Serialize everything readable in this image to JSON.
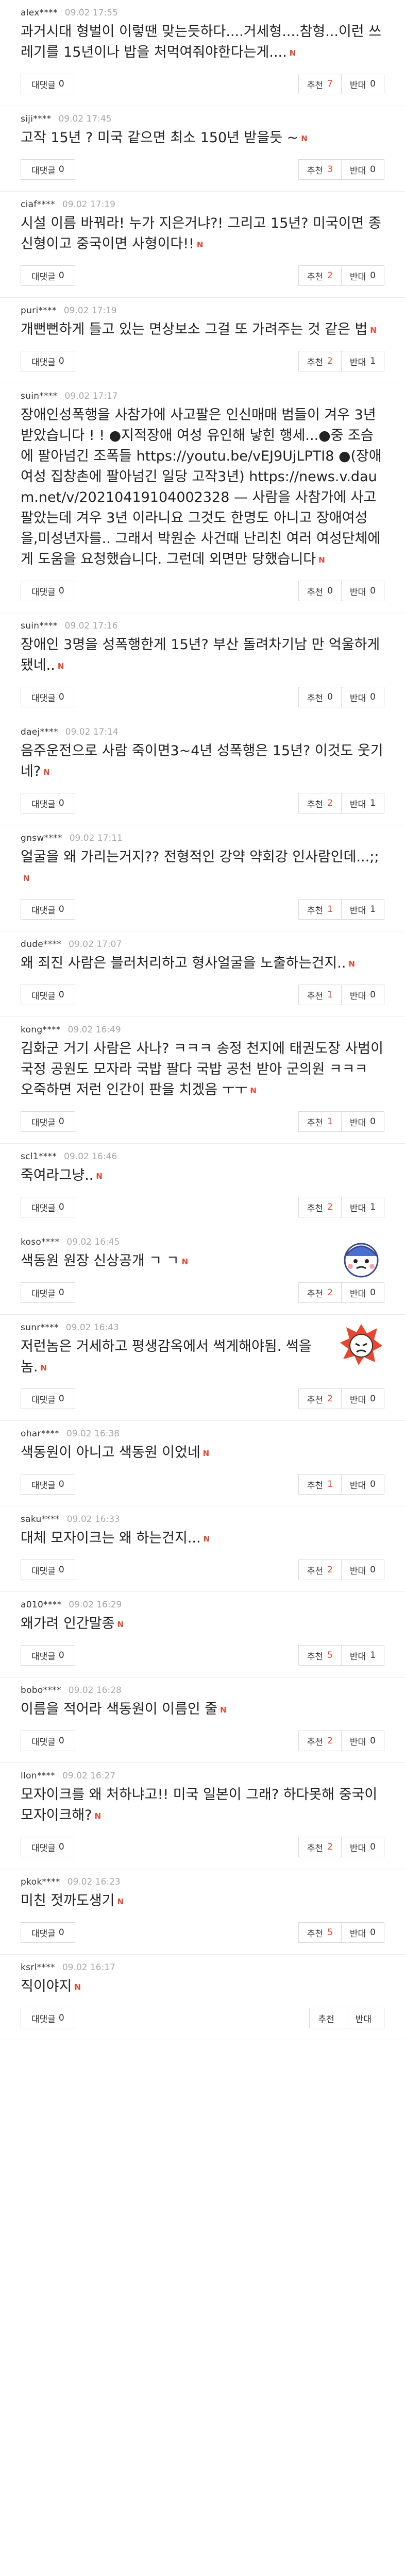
{
  "labels": {
    "reply": "대댓글",
    "up": "추천",
    "down": "반대",
    "new": "N"
  },
  "comments": [
    {
      "nick": "alex****",
      "date": "09.02 17:55",
      "text": "과거시대 형벌이 이렇땐 맞는듯하다....거세형....참형...이런 쓰레기를 15년이나 밥을 처먹여줘야한다는게....",
      "replies": "0",
      "up": "7",
      "down": "0",
      "sticker": ""
    },
    {
      "nick": "siji****",
      "date": "09.02 17:45",
      "text": "고작 15년 ? 미국 같으면 최소 150년 받을듯 ~",
      "replies": "0",
      "up": "3",
      "down": "0",
      "sticker": ""
    },
    {
      "nick": "ciaf****",
      "date": "09.02 17:19",
      "text": "시설 이름 바꿔라! 누가 지은거냐?! 그리고 15년? 미국이면 종신형이고 중국이면 사형이다!!",
      "replies": "0",
      "up": "2",
      "down": "0",
      "sticker": ""
    },
    {
      "nick": "puri****",
      "date": "09.02 17:19",
      "text": "개뻔뻔하게 들고 있는 면상보소 그걸 또 가려주는 것 같은 법",
      "replies": "0",
      "up": "2",
      "down": "1",
      "sticker": ""
    },
    {
      "nick": "suin****",
      "date": "09.02 17:17",
      "text": "장애인성폭행을 사참가에 사고팔은 인신매매 범들이 겨우 3년 받았습니다 ! ! ●지적장애 여성 유인해 낳힌 행세...●중 조슴에 팔아넘긴 조폭들 https://youtu.be/vEJ9UjLPTI8 ●(장애여성 집창촌에 팔아넘긴 일당 고작3년) https://news.v.daum.net/v/20210419104002328 — 사람을 사참가에 사고 팔았는데 겨우 3년 이라니요 그것도 한명도 아니고 장애여성을,미성년자를.. 그래서 박원순 사건때 난리친 여러 여성단체에게 도움을 요청했습니다. 그런데 외면만 당했습니다",
      "replies": "0",
      "up": "0",
      "down": "0",
      "sticker": ""
    },
    {
      "nick": "suin****",
      "date": "09.02 17:16",
      "text": "장애인 3명을 성폭행한게 15년? 부산 돌려차기남 만 억울하게 됐네..",
      "replies": "0",
      "up": "0",
      "down": "0",
      "sticker": ""
    },
    {
      "nick": "daej****",
      "date": "09.02 17:14",
      "text": "음주운전으로 사람 죽이면3~4년 성폭행은 15년? 이것도 웃기네?",
      "replies": "0",
      "up": "2",
      "down": "1",
      "sticker": ""
    },
    {
      "nick": "gnsw****",
      "date": "09.02 17:11",
      "text": "얼굴을 왜 가리는거지?? 전형적인 강약 약회강 인사람인데...;;",
      "replies": "0",
      "up": "1",
      "down": "1",
      "sticker": ""
    },
    {
      "nick": "dude****",
      "date": "09.02 17:07",
      "text": "왜 죄진 사람은 블러처리하고 형사얼굴을 노출하는건지..",
      "replies": "0",
      "up": "1",
      "down": "0",
      "sticker": ""
    },
    {
      "nick": "kong****",
      "date": "09.02 16:49",
      "text": "김화군 거기 사람은 사나? ㅋㅋㅋ 송정 천지에 태권도장 사범이 국정 공원도 모자라 국밥 팔다 국밥 공천 받아 군의원 ㅋㅋㅋ 오죽하면 저런 인간이 판을 치겠음 ㅜㅜ",
      "replies": "0",
      "up": "1",
      "down": "0",
      "sticker": ""
    },
    {
      "nick": "scl1****",
      "date": "09.02 16:46",
      "text": "죽여라그냥..",
      "replies": "0",
      "up": "2",
      "down": "1",
      "sticker": ""
    },
    {
      "nick": "koso****",
      "date": "09.02 16:45",
      "text": "색동원 원장 신상공개 ㄱ ㄱ",
      "replies": "0",
      "up": "2",
      "down": "0",
      "sticker": "blue"
    },
    {
      "nick": "sunr****",
      "date": "09.02 16:43",
      "text": "저런놈은 거세하고 평생감옥에서 썩게해야됨. 썩을놈.",
      "replies": "0",
      "up": "2",
      "down": "0",
      "sticker": "red"
    },
    {
      "nick": "ohar****",
      "date": "09.02 16:38",
      "text": "색동원이 아니고 색동원 이었네",
      "replies": "0",
      "up": "1",
      "down": "0",
      "sticker": ""
    },
    {
      "nick": "saku****",
      "date": "09.02 16:33",
      "text": "대체 모자이크는 왜 하는건지...",
      "replies": "0",
      "up": "2",
      "down": "0",
      "sticker": ""
    },
    {
      "nick": "a010****",
      "date": "09.02 16:29",
      "text": "왜가려 인간말종",
      "replies": "0",
      "up": "5",
      "down": "1",
      "sticker": ""
    },
    {
      "nick": "bobo****",
      "date": "09.02 16:28",
      "text": "이름을 적어라 색동원이 이름인 줄",
      "replies": "0",
      "up": "2",
      "down": "0",
      "sticker": ""
    },
    {
      "nick": "llon****",
      "date": "09.02 16:27",
      "text": "모자이크를 왜 처하냐고!! 미국 일본이 그래? 하다못해 중국이 모자이크해?",
      "replies": "0",
      "up": "2",
      "down": "0",
      "sticker": ""
    },
    {
      "nick": "pkok****",
      "date": "09.02 16:23",
      "text": "미친 젓까도생기",
      "replies": "0",
      "up": "5",
      "down": "0",
      "sticker": ""
    },
    {
      "nick": "ksrl****",
      "date": "09.02 16:17",
      "text": "직이야지",
      "replies": "0",
      "up": "",
      "down": "",
      "sticker": ""
    }
  ]
}
